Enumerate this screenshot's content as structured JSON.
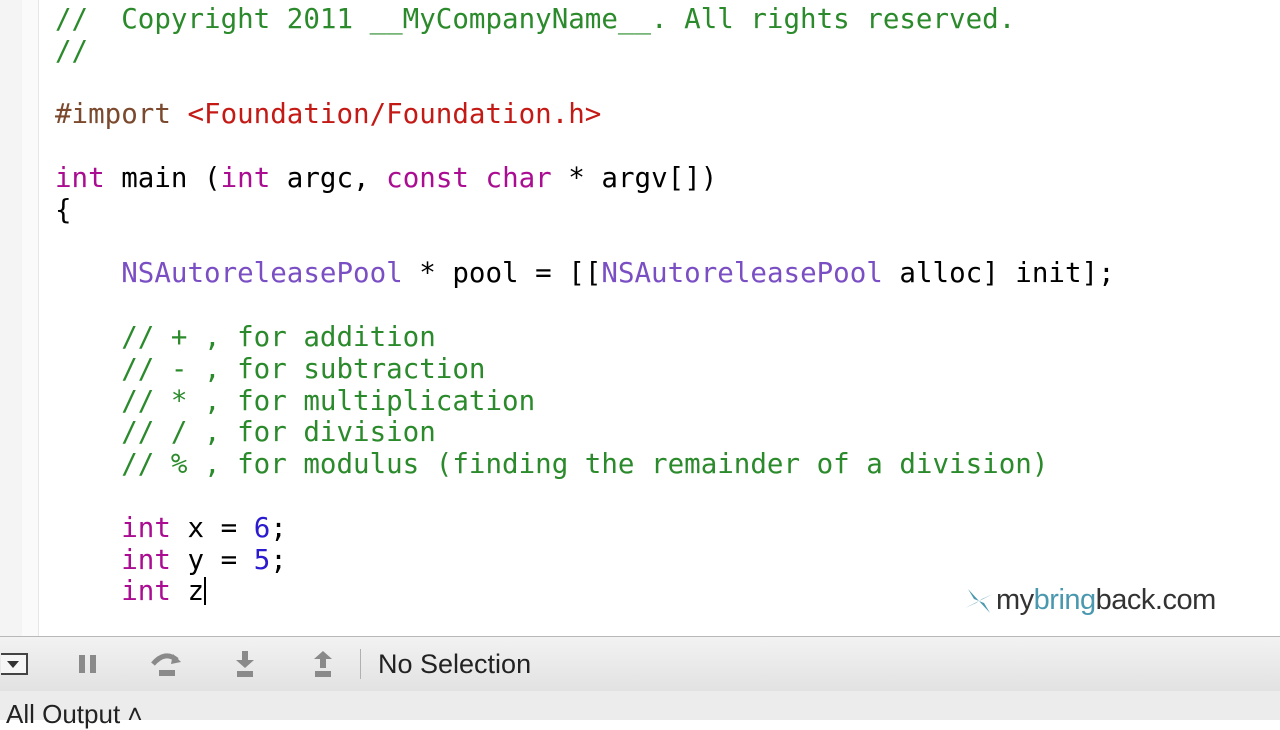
{
  "colors": {
    "comment": "#2b8a2b",
    "preproc": "#7b4a2e",
    "string": "#c41a16",
    "keyword": "#aa0d91",
    "class": "#7b4fc4",
    "number": "#2a1ad0",
    "plain": "#000000",
    "logo_accent": "#4a98b0"
  },
  "code_lines": [
    [
      {
        "t": "//  Copyright 2011 __MyCompanyName__. All rights reserved.",
        "c": "comment"
      }
    ],
    [
      {
        "t": "//",
        "c": "comment"
      }
    ],
    [],
    [
      {
        "t": "#import ",
        "c": "preproc"
      },
      {
        "t": "<Foundation/Foundation.h>",
        "c": "string"
      }
    ],
    [],
    [
      {
        "t": "int",
        "c": "keyword"
      },
      {
        "t": " main (",
        "c": "plain"
      },
      {
        "t": "int",
        "c": "keyword"
      },
      {
        "t": " argc, ",
        "c": "plain"
      },
      {
        "t": "const",
        "c": "keyword"
      },
      {
        "t": " ",
        "c": "plain"
      },
      {
        "t": "char",
        "c": "keyword"
      },
      {
        "t": " * argv[])",
        "c": "plain"
      }
    ],
    [
      {
        "t": "{",
        "c": "plain"
      }
    ],
    [],
    [
      {
        "t": "    ",
        "c": "plain"
      },
      {
        "t": "NSAutoreleasePool",
        "c": "class"
      },
      {
        "t": " * pool = [[",
        "c": "plain"
      },
      {
        "t": "NSAutoreleasePool",
        "c": "class"
      },
      {
        "t": " alloc] init];",
        "c": "plain"
      }
    ],
    [],
    [
      {
        "t": "    // + , for addition",
        "c": "comment"
      }
    ],
    [
      {
        "t": "    // - , for subtraction",
        "c": "comment"
      }
    ],
    [
      {
        "t": "    // * , for multiplication",
        "c": "comment"
      }
    ],
    [
      {
        "t": "    // / , for division",
        "c": "comment"
      }
    ],
    [
      {
        "t": "    // % , for modulus (finding the remainder of a division)",
        "c": "comment"
      }
    ],
    [],
    [
      {
        "t": "    ",
        "c": "plain"
      },
      {
        "t": "int",
        "c": "keyword"
      },
      {
        "t": " x = ",
        "c": "plain"
      },
      {
        "t": "6",
        "c": "number"
      },
      {
        "t": ";",
        "c": "plain"
      }
    ],
    [
      {
        "t": "    ",
        "c": "plain"
      },
      {
        "t": "int",
        "c": "keyword"
      },
      {
        "t": " y = ",
        "c": "plain"
      },
      {
        "t": "5",
        "c": "number"
      },
      {
        "t": ";",
        "c": "plain"
      }
    ],
    [
      {
        "t": "    ",
        "c": "plain"
      },
      {
        "t": "int",
        "c": "keyword"
      },
      {
        "t": " z",
        "c": "plain"
      }
    ]
  ],
  "debug_bar": {
    "selection_label": "No Selection",
    "icons": [
      "console-toggle-icon",
      "pause-icon",
      "step-over-icon",
      "step-into-icon",
      "step-out-icon"
    ]
  },
  "output": {
    "filter_label": "All Output ˄"
  },
  "watermark": {
    "pre": "my",
    "accent": "bring",
    "post": "back.com"
  }
}
